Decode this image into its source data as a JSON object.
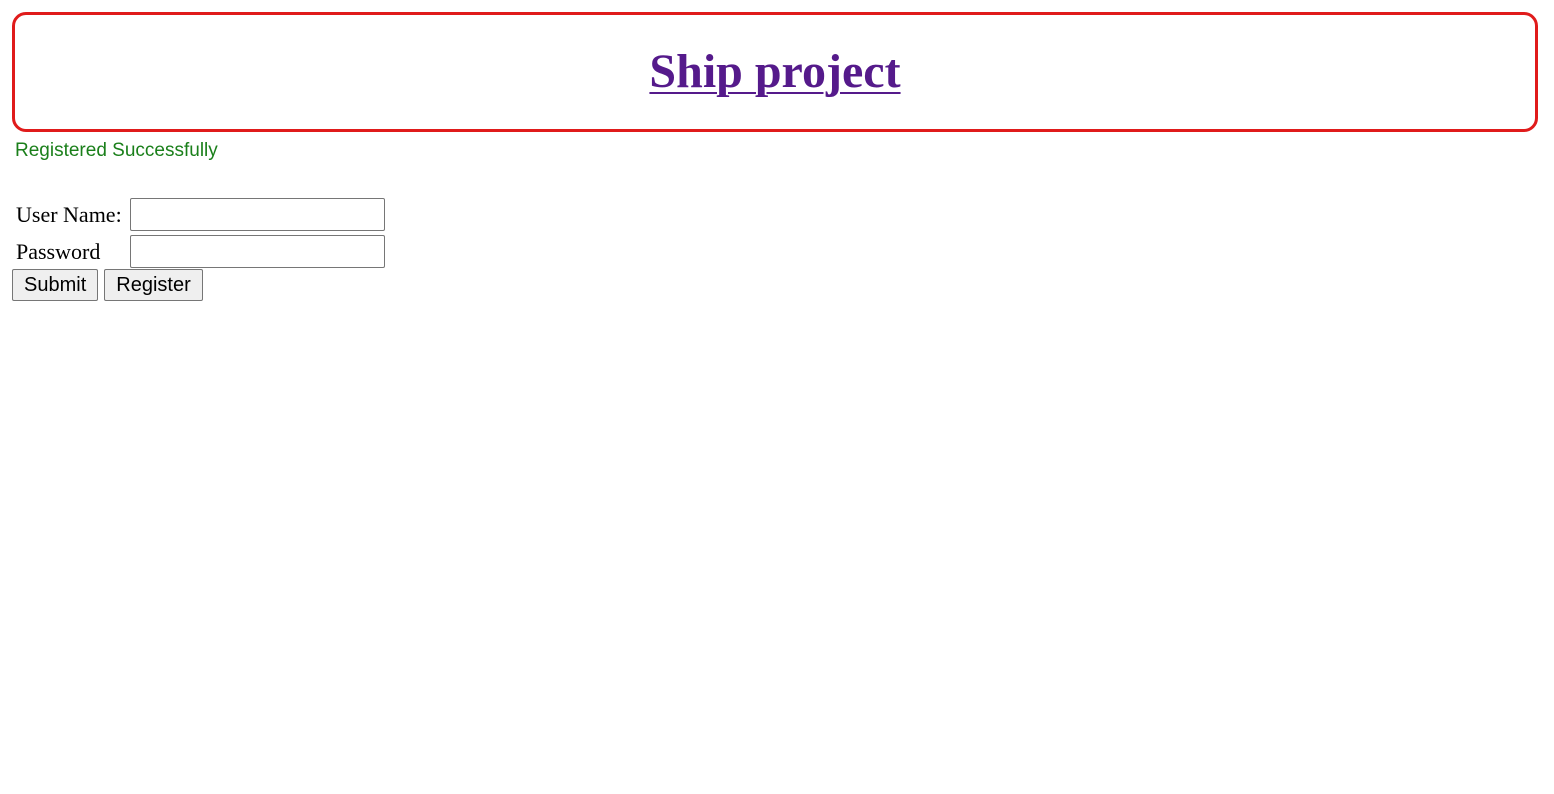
{
  "header": {
    "title": "Ship project",
    "border_color": "#e01b1b",
    "link_color": "#551a8b"
  },
  "status": {
    "message": "Registered Successfully",
    "color": "#1a7f1a"
  },
  "form": {
    "username": {
      "label": "User Name:",
      "value": ""
    },
    "password": {
      "label": "Password",
      "value": ""
    },
    "submit_label": "Submit",
    "register_label": "Register"
  }
}
